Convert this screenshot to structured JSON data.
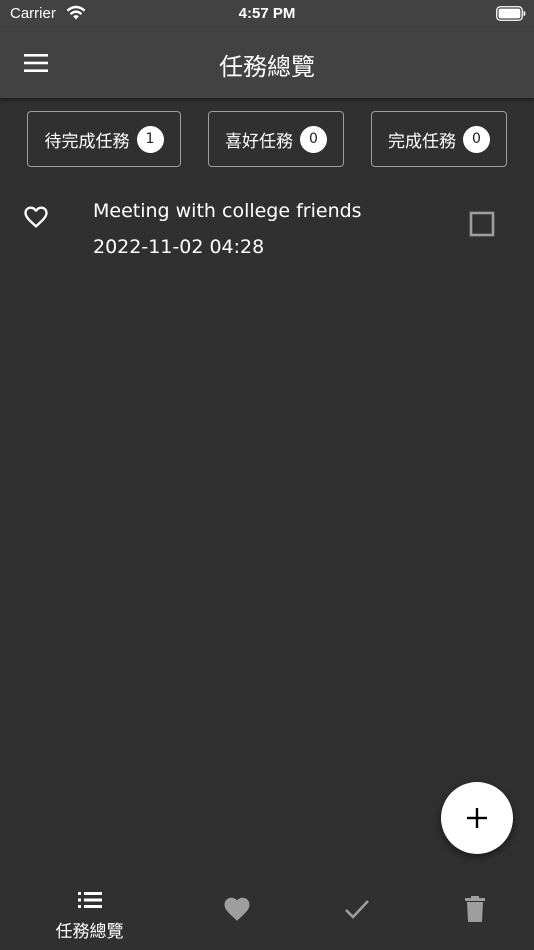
{
  "status_bar": {
    "carrier": "Carrier",
    "time": "4:57 PM"
  },
  "app_bar": {
    "title": "任務總覽",
    "menu_icon": "hamburger-menu-icon"
  },
  "filters": [
    {
      "label": "待完成任務",
      "count": "1"
    },
    {
      "label": "喜好任務",
      "count": "0"
    },
    {
      "label": "完成任務",
      "count": "0"
    }
  ],
  "tasks": [
    {
      "title": "Meeting with college friends",
      "datetime": "2022-11-02 04:28",
      "favorite_icon": "heart-outline-icon",
      "checkbox_icon": "checkbox-unchecked-icon"
    }
  ],
  "fab": {
    "icon": "plus-icon"
  },
  "bottom_nav": {
    "items": [
      {
        "label": "任務總覽",
        "icon": "list-icon",
        "active": true
      },
      {
        "icon": "heart-icon"
      },
      {
        "icon": "check-icon"
      },
      {
        "icon": "trash-icon"
      }
    ]
  },
  "colors": {
    "background": "#303030",
    "app_bar": "#424242",
    "text": "#ffffff",
    "muted_icon": "#9e9e9e",
    "badge_bg": "#ffffff"
  }
}
